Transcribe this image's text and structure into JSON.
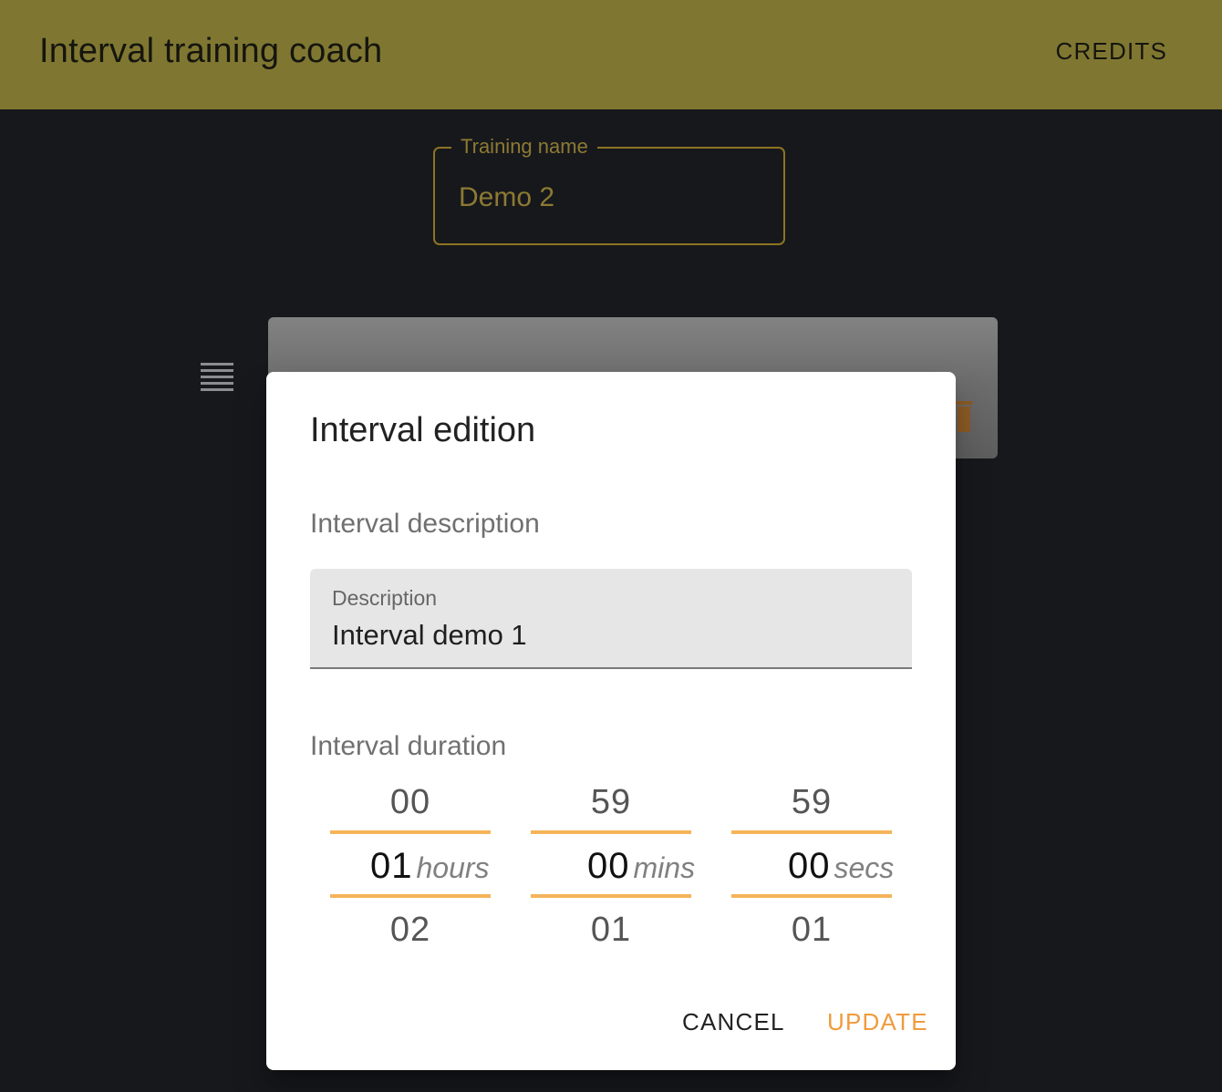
{
  "app_bar": {
    "title": "Interval training coach",
    "credits_label": "CREDITS"
  },
  "training": {
    "label": "Training name",
    "value": "Demo 2"
  },
  "interval_card": {
    "drag_icon": "drag-handle-icon",
    "delete_icon": "trash-icon"
  },
  "dialog": {
    "title": "Interval edition",
    "description_section": "Interval description",
    "description_field": {
      "label": "Description",
      "value": "Interval demo 1"
    },
    "duration_section": "Interval duration",
    "picker": {
      "hours": {
        "prev": "00",
        "current": "01",
        "next": "02",
        "unit": "hours"
      },
      "mins": {
        "prev": "59",
        "current": "00",
        "next": "01",
        "unit": "mins"
      },
      "secs": {
        "prev": "59",
        "current": "00",
        "next": "01",
        "unit": "secs"
      }
    },
    "cancel_label": "CANCEL",
    "update_label": "UPDATE"
  },
  "colors": {
    "app_bar": "#7f7731",
    "background": "#17181c",
    "accent": "#f09b3d",
    "picker_line": "#f5b45a",
    "training_field": "#8c7a33"
  }
}
